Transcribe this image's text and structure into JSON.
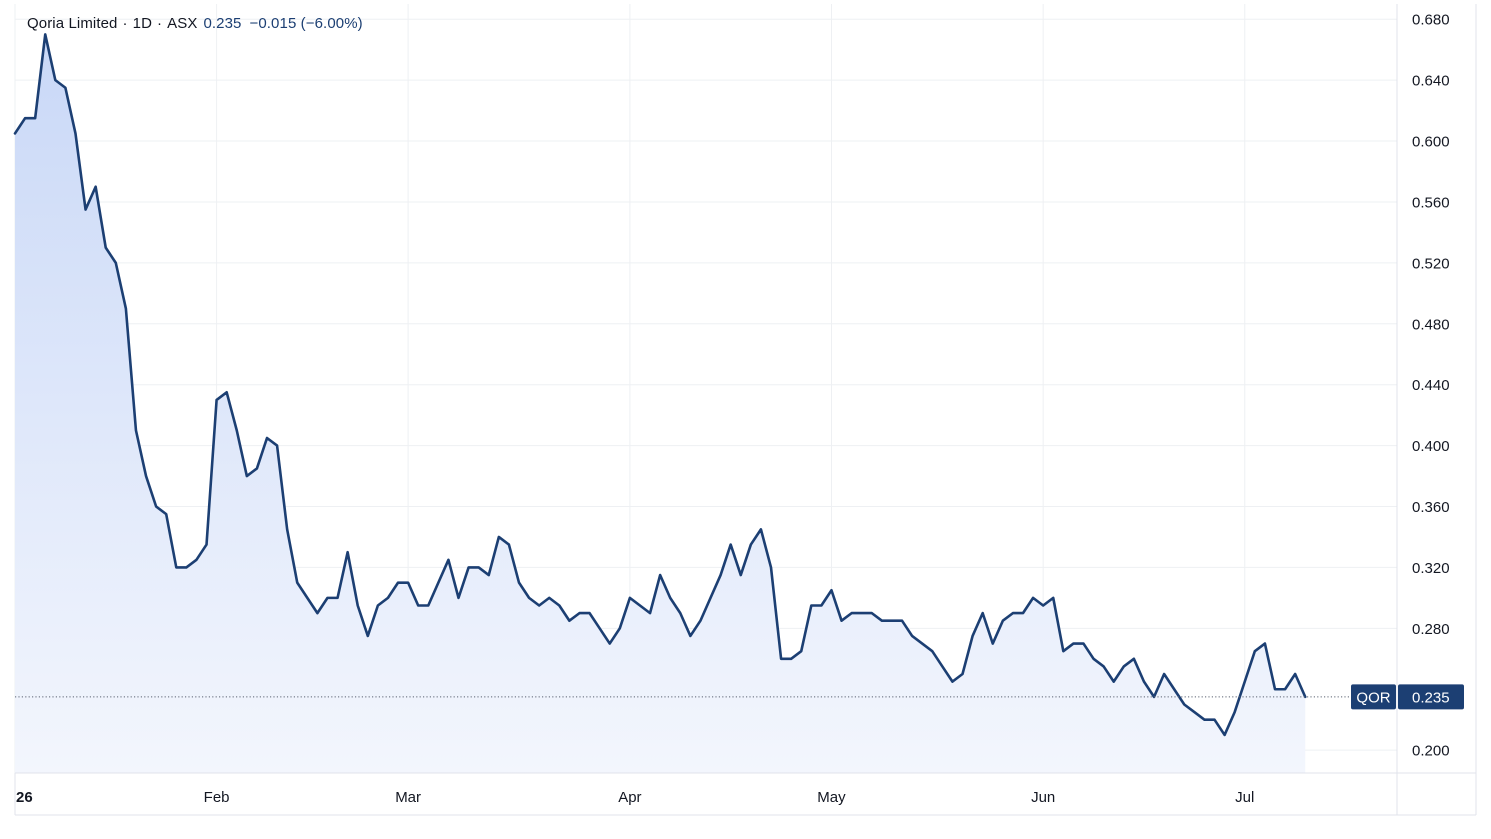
{
  "header": {
    "name": "Qoria Limited",
    "interval": "1D",
    "exchange": "ASX",
    "price": "0.235",
    "change": "−0.015 (−6.00%)",
    "separator": "·"
  },
  "price_tag": {
    "symbol": "QOR",
    "value": "0.235"
  },
  "colors": {
    "line": "#1c3f73",
    "fill_top": "#c9d8f7",
    "fill_bottom": "#f3f6fd",
    "grid": "#eef0f3",
    "axis_text": "#131722",
    "tag_bg": "#1c3f73",
    "tag_text": "#ffffff"
  },
  "chart_data": {
    "type": "area",
    "title": "Qoria Limited · 1D · ASX",
    "xlabel": "",
    "ylabel": "",
    "ylim": [
      0.185,
      0.69
    ],
    "yticks": [
      0.68,
      0.64,
      0.6,
      0.56,
      0.52,
      0.48,
      0.44,
      0.4,
      0.36,
      0.32,
      0.28,
      0.2
    ],
    "ytick_labels": [
      "0.680",
      "0.640",
      "0.600",
      "0.560",
      "0.520",
      "0.480",
      "0.440",
      "0.400",
      "0.360",
      "0.320",
      "0.280",
      "0.200"
    ],
    "x_ticks": [
      {
        "label": "26",
        "index": 0,
        "bold": true
      },
      {
        "label": "Feb",
        "index": 20,
        "bold": false
      },
      {
        "label": "Mar",
        "index": 39,
        "bold": false
      },
      {
        "label": "Apr",
        "index": 61,
        "bold": false
      },
      {
        "label": "May",
        "index": 81,
        "bold": false
      },
      {
        "label": "Jun",
        "index": 102,
        "bold": false
      },
      {
        "label": "Jul",
        "index": 122,
        "bold": false
      }
    ],
    "grid": true,
    "last_value_line": 0.235,
    "series": [
      {
        "name": "QOR",
        "values": [
          0.605,
          0.615,
          0.615,
          0.67,
          0.64,
          0.635,
          0.605,
          0.555,
          0.57,
          0.53,
          0.52,
          0.49,
          0.41,
          0.38,
          0.36,
          0.355,
          0.32,
          0.32,
          0.325,
          0.335,
          0.43,
          0.435,
          0.41,
          0.38,
          0.385,
          0.405,
          0.4,
          0.345,
          0.31,
          0.3,
          0.29,
          0.3,
          0.3,
          0.33,
          0.295,
          0.275,
          0.295,
          0.3,
          0.31,
          0.31,
          0.295,
          0.295,
          0.31,
          0.325,
          0.3,
          0.32,
          0.32,
          0.315,
          0.34,
          0.335,
          0.31,
          0.3,
          0.295,
          0.3,
          0.295,
          0.285,
          0.29,
          0.29,
          0.28,
          0.27,
          0.28,
          0.3,
          0.295,
          0.29,
          0.315,
          0.3,
          0.29,
          0.275,
          0.285,
          0.3,
          0.315,
          0.335,
          0.315,
          0.335,
          0.345,
          0.32,
          0.26,
          0.26,
          0.265,
          0.295,
          0.295,
          0.305,
          0.285,
          0.29,
          0.29,
          0.29,
          0.285,
          0.285,
          0.285,
          0.275,
          0.27,
          0.265,
          0.255,
          0.245,
          0.25,
          0.275,
          0.29,
          0.27,
          0.285,
          0.29,
          0.29,
          0.3,
          0.295,
          0.3,
          0.265,
          0.27,
          0.27,
          0.26,
          0.255,
          0.245,
          0.255,
          0.26,
          0.245,
          0.235,
          0.25,
          0.24,
          0.23,
          0.225,
          0.22,
          0.22,
          0.21,
          0.225,
          0.245,
          0.265,
          0.27,
          0.24,
          0.24,
          0.25,
          0.235
        ]
      }
    ]
  }
}
